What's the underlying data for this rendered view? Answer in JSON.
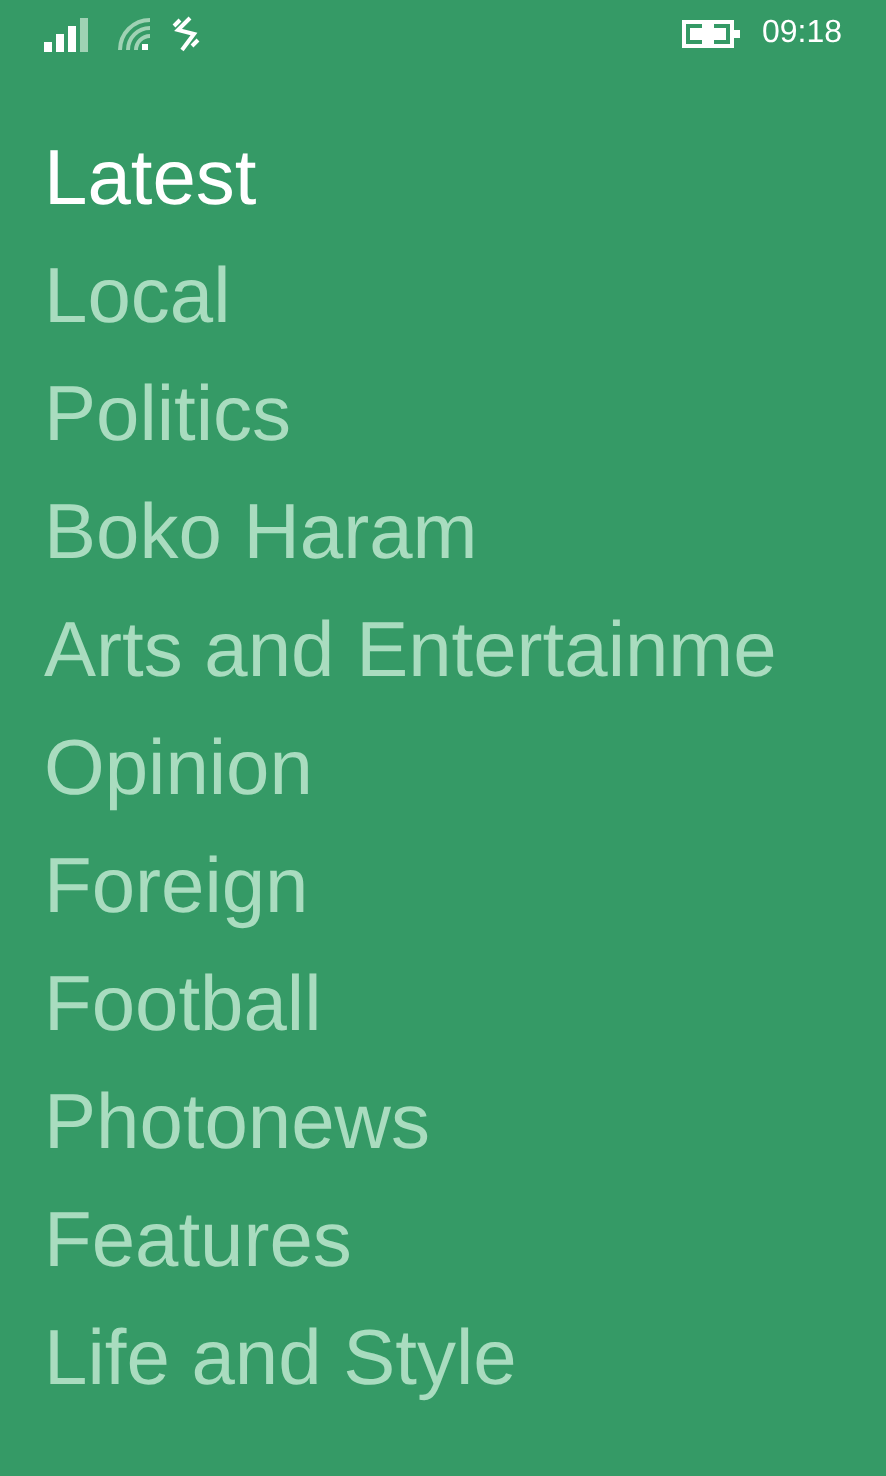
{
  "status_bar": {
    "time": "09:18"
  },
  "menu": [
    {
      "label": "Latest",
      "selected": true
    },
    {
      "label": "Local",
      "selected": false
    },
    {
      "label": "Politics",
      "selected": false
    },
    {
      "label": "Boko Haram",
      "selected": false
    },
    {
      "label": "Arts and Entertainme",
      "selected": false
    },
    {
      "label": "Opinion",
      "selected": false
    },
    {
      "label": "Foreign",
      "selected": false
    },
    {
      "label": "Football",
      "selected": false
    },
    {
      "label": "Photonews",
      "selected": false
    },
    {
      "label": "Features",
      "selected": false
    },
    {
      "label": "Life and Style",
      "selected": false
    }
  ]
}
